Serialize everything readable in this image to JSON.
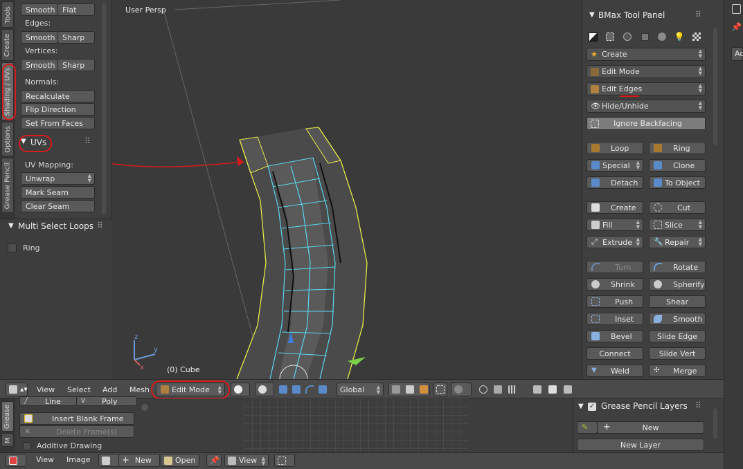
{
  "left_tabs": [
    "Tools",
    "Create",
    "Shading / UVs",
    "Options",
    "Grease Pencil"
  ],
  "shading": {
    "faces_smooth": "Smooth",
    "faces_flat": "Flat",
    "edges_label": "Edges:",
    "edges_smooth": "Smooth",
    "edges_sharp": "Sharp",
    "vertices_label": "Vertices:",
    "vertices_smooth": "Smooth",
    "vertices_sharp": "Sharp",
    "normals_label": "Normals:",
    "recalculate": "Recalculate",
    "flip_direction": "Flip Direction",
    "set_from_faces": "Set From Faces"
  },
  "uvs": {
    "title": "UVs",
    "mapping_label": "UV Mapping:",
    "unwrap": "Unwrap",
    "mark_seam": "Mark Seam",
    "clear_seam": "Clear Seam"
  },
  "multi_select": {
    "title": "Multi Select Loops",
    "ring": "Ring"
  },
  "viewport": {
    "view_name": "User Persp",
    "object_label": "(0) Cube"
  },
  "bmax": {
    "title": "BMax Tool Panel",
    "create": "Create",
    "edit_mode": "Edit Mode",
    "edit_edges": "Edit Edges",
    "hide_unhide": "Hide/Unhide",
    "ignore_backfacing": "Ignore Backfacing",
    "loop": "Loop",
    "ring": "Ring",
    "special": "Special",
    "clone": "Clone",
    "detach": "Detach",
    "to_object": "To Object",
    "create2": "Create",
    "cut": "Cut",
    "fill": "Fill",
    "slice": "Slice",
    "extrude": "Extrude",
    "repair": "Repair",
    "turn": "Turn",
    "rotate": "Rotate",
    "shrink": "Shrink",
    "spherify": "Spherify",
    "push": "Push",
    "shear": "Shear",
    "inset": "Inset",
    "smooth": "Smooth",
    "bevel": "Bevel",
    "slide_edge": "Slide Edge",
    "connect": "Connect",
    "slide_vert": "Slide Vert",
    "weld": "Weld",
    "merge": "Merge"
  },
  "header3d": {
    "view": "View",
    "select": "Select",
    "add": "Add",
    "mesh": "Mesh",
    "mode": "Edit Mode",
    "orientation": "Global"
  },
  "gp_tools": {
    "line": "Line",
    "poly": "Poly",
    "insert_blank": "Insert Blank Frame",
    "delete_frames": "Delete Frame(s)",
    "additive": "Additive Drawing",
    "tab_grease": "Grease",
    "tab_m": "M"
  },
  "gp_layers": {
    "title": "Grease Pencil Layers",
    "new": "New",
    "new_layer": "New Layer"
  },
  "image_header": {
    "view": "View",
    "image": "Image",
    "new": "New",
    "open": "Open",
    "view2": "View"
  },
  "far_right": {
    "ad": "Ad"
  }
}
